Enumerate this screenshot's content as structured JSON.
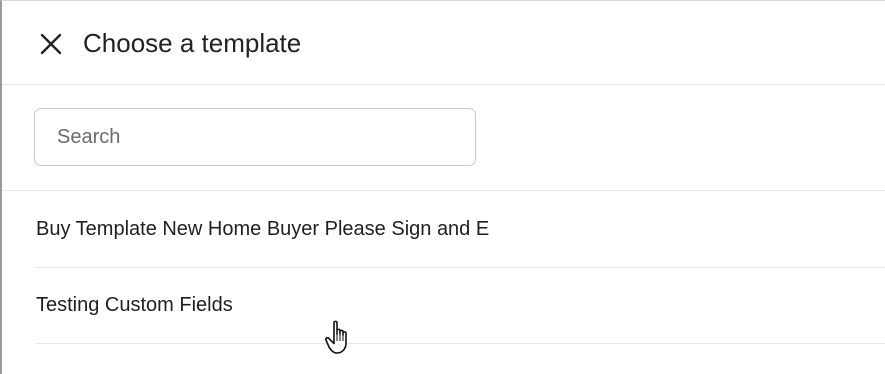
{
  "header": {
    "title": "Choose a template",
    "close_icon": "close-icon"
  },
  "search": {
    "placeholder": "Search",
    "value": ""
  },
  "templates": [
    {
      "label": "Buy Template New Home Buyer Please Sign and E"
    },
    {
      "label": "Testing Custom Fields"
    }
  ],
  "cursor": {
    "icon": "hand-pointer-icon"
  },
  "colors": {
    "border": "#e6e6e6",
    "input_border": "#c9c9c9",
    "text": "#1f1f1f",
    "placeholder": "#6b6b6b"
  }
}
